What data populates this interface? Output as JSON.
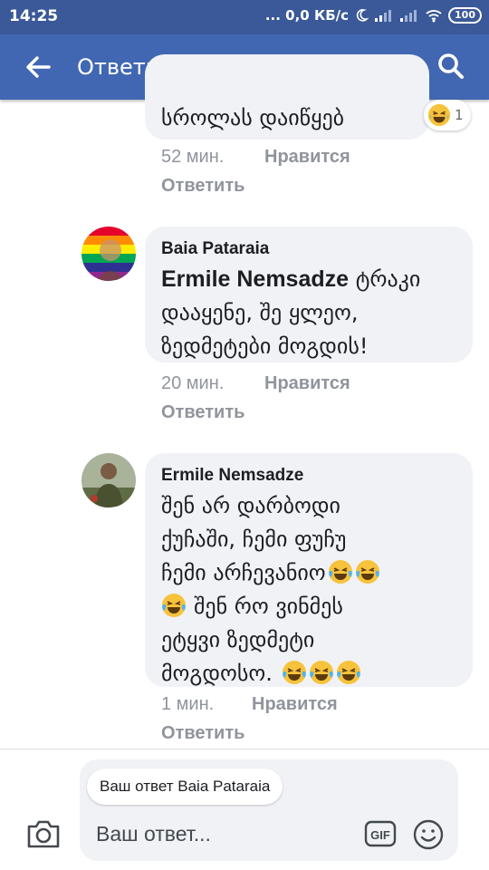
{
  "status_bar": {
    "time": "14:25",
    "network": "... 0,0 КБ/с",
    "battery": "100"
  },
  "header": {
    "title": "Ответы",
    "back_icon": "arrow-left-icon",
    "search_icon": "search-icon"
  },
  "comments": [
    {
      "author": "",
      "text": "სროლას დაიწყებ",
      "reaction_count": "1",
      "time": "52 мин.",
      "like_label": "Нравится",
      "reply_label": "Ответить"
    },
    {
      "author": "Baia Pataraia",
      "mention": "Ermile Nemsadze",
      "text_lines": [
        "ტრაკი",
        "დააყენე, შე ყლეო,",
        "ზედმეტები მოგდის!"
      ],
      "time": "20 мин.",
      "like_label": "Нравится",
      "reply_label": "Ответить"
    },
    {
      "author": "Ermile Nemsadze",
      "text_lines": [
        "შენ არ დარბოდი",
        "ქუჩაში, ჩემი ფუჩუ",
        "ჩემი არჩევანიო",
        "შენ რო ვინმეს",
        "ეტყვი ზედმეტი",
        "მოგდოსო."
      ],
      "time": "1 мин.",
      "like_label": "Нравится",
      "reply_label": "Ответить"
    }
  ],
  "composer": {
    "reply_to": "Ваш ответ Baia Pataraia",
    "placeholder": "Ваш ответ...",
    "gif_label": "GIF"
  },
  "colors": {
    "brand": "#4267b2",
    "status_bar": "#3b5998",
    "bubble": "#f0f2f5",
    "meta": "#90949c"
  }
}
